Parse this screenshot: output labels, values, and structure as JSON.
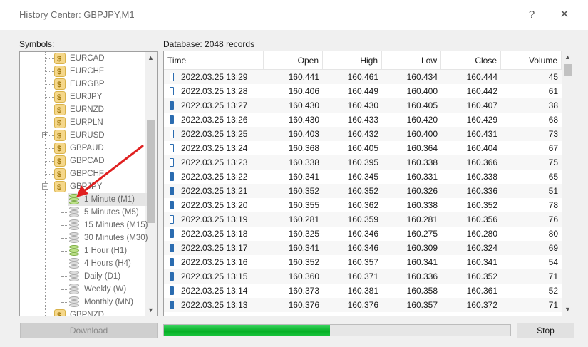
{
  "window": {
    "title": "History Center: GBPJPY,M1",
    "help_glyph": "?",
    "close_glyph": "✕"
  },
  "symbols_label": "Symbols:",
  "database_label": "Database: 2048 records",
  "tree": {
    "symbols": [
      {
        "name": "EURCAD",
        "expander": ""
      },
      {
        "name": "EURCHF",
        "expander": ""
      },
      {
        "name": "EURGBP",
        "expander": ""
      },
      {
        "name": "EURJPY",
        "expander": ""
      },
      {
        "name": "EURNZD",
        "expander": ""
      },
      {
        "name": "EURPLN",
        "expander": ""
      },
      {
        "name": "EURUSD",
        "expander": "+"
      },
      {
        "name": "GBPAUD",
        "expander": ""
      },
      {
        "name": "GBPCAD",
        "expander": ""
      },
      {
        "name": "GBPCHF",
        "expander": ""
      },
      {
        "name": "GBPJPY",
        "expander": "−"
      }
    ],
    "timeframes": [
      {
        "label": "1 Minute (M1)",
        "has_data": true
      },
      {
        "label": "5 Minutes (M5)",
        "has_data": false
      },
      {
        "label": "15 Minutes (M15)",
        "has_data": false
      },
      {
        "label": "30 Minutes (M30)",
        "has_data": false
      },
      {
        "label": "1 Hour (H1)",
        "has_data": true
      },
      {
        "label": "4 Hours (H4)",
        "has_data": false
      },
      {
        "label": "Daily (D1)",
        "has_data": false
      },
      {
        "label": "Weekly (W)",
        "has_data": false
      },
      {
        "label": "Monthly (MN)",
        "has_data": false
      }
    ],
    "next_symbol": "GBPNZD"
  },
  "table": {
    "headers": [
      "Time",
      "Open",
      "High",
      "Low",
      "Close",
      "Volume"
    ],
    "rows": [
      {
        "type": "bull",
        "time": "2022.03.25 13:29",
        "open": "160.441",
        "high": "160.461",
        "low": "160.434",
        "close": "160.444",
        "volume": "45"
      },
      {
        "type": "bull",
        "time": "2022.03.25 13:28",
        "open": "160.406",
        "high": "160.449",
        "low": "160.400",
        "close": "160.442",
        "volume": "61"
      },
      {
        "type": "bear",
        "time": "2022.03.25 13:27",
        "open": "160.430",
        "high": "160.430",
        "low": "160.405",
        "close": "160.407",
        "volume": "38"
      },
      {
        "type": "bear",
        "time": "2022.03.25 13:26",
        "open": "160.430",
        "high": "160.433",
        "low": "160.420",
        "close": "160.429",
        "volume": "68"
      },
      {
        "type": "bull",
        "time": "2022.03.25 13:25",
        "open": "160.403",
        "high": "160.432",
        "low": "160.400",
        "close": "160.431",
        "volume": "73"
      },
      {
        "type": "bull",
        "time": "2022.03.25 13:24",
        "open": "160.368",
        "high": "160.405",
        "low": "160.364",
        "close": "160.404",
        "volume": "67"
      },
      {
        "type": "bull",
        "time": "2022.03.25 13:23",
        "open": "160.338",
        "high": "160.395",
        "low": "160.338",
        "close": "160.366",
        "volume": "75"
      },
      {
        "type": "bear",
        "time": "2022.03.25 13:22",
        "open": "160.341",
        "high": "160.345",
        "low": "160.331",
        "close": "160.338",
        "volume": "65"
      },
      {
        "type": "bear",
        "time": "2022.03.25 13:21",
        "open": "160.352",
        "high": "160.352",
        "low": "160.326",
        "close": "160.336",
        "volume": "51"
      },
      {
        "type": "bear",
        "time": "2022.03.25 13:20",
        "open": "160.355",
        "high": "160.362",
        "low": "160.338",
        "close": "160.352",
        "volume": "78"
      },
      {
        "type": "bull",
        "time": "2022.03.25 13:19",
        "open": "160.281",
        "high": "160.359",
        "low": "160.281",
        "close": "160.356",
        "volume": "76"
      },
      {
        "type": "bear",
        "time": "2022.03.25 13:18",
        "open": "160.325",
        "high": "160.346",
        "low": "160.275",
        "close": "160.280",
        "volume": "80"
      },
      {
        "type": "bear",
        "time": "2022.03.25 13:17",
        "open": "160.341",
        "high": "160.346",
        "low": "160.309",
        "close": "160.324",
        "volume": "69"
      },
      {
        "type": "bear",
        "time": "2022.03.25 13:16",
        "open": "160.352",
        "high": "160.357",
        "low": "160.341",
        "close": "160.341",
        "volume": "54"
      },
      {
        "type": "bear",
        "time": "2022.03.25 13:15",
        "open": "160.360",
        "high": "160.371",
        "low": "160.336",
        "close": "160.352",
        "volume": "71"
      },
      {
        "type": "bear",
        "time": "2022.03.25 13:14",
        "open": "160.373",
        "high": "160.381",
        "low": "160.358",
        "close": "160.361",
        "volume": "52"
      },
      {
        "type": "bear",
        "time": "2022.03.25 13:13",
        "open": "160.376",
        "high": "160.376",
        "low": "160.357",
        "close": "160.372",
        "volume": "71"
      }
    ]
  },
  "buttons": {
    "download": "Download",
    "stop": "Stop"
  },
  "progress": {
    "fraction": 0.48
  },
  "colors": {
    "progress_green": "#06b025",
    "candle_blue": "#2b6cb0",
    "annotation_red": "#e02020"
  },
  "icons": {
    "symbol": "dollar-coin-icon",
    "timeframe": "database-icon",
    "annotation": "red-arrow-icon"
  }
}
